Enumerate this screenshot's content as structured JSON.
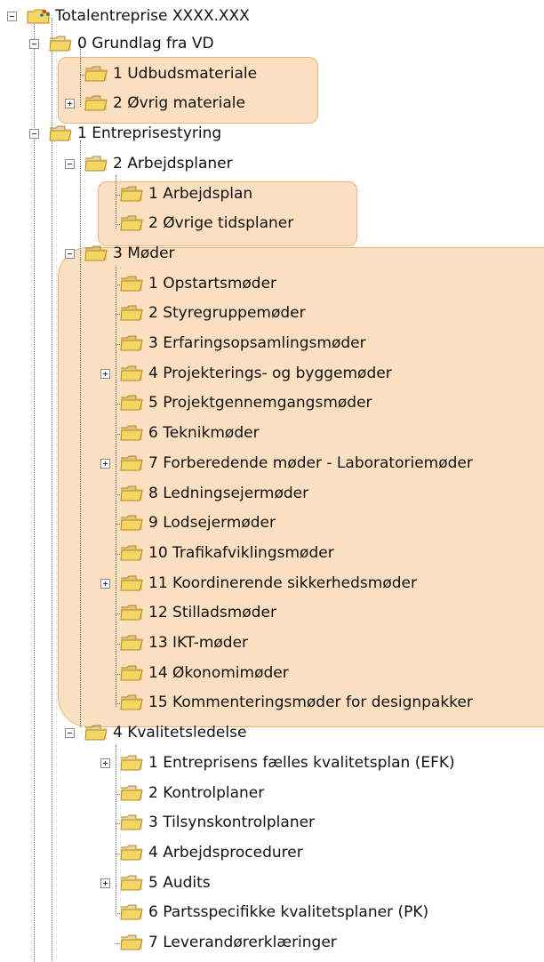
{
  "tree": {
    "root": {
      "label": "Totalentreprise XXXX.XXX",
      "icon": "project-root-icon"
    },
    "items": [
      {
        "label": "0 Grundlag fra VD",
        "level": 1,
        "expander": "minus"
      },
      {
        "label": "1 Udbudsmateriale",
        "level": 2,
        "expander": "none"
      },
      {
        "label": "2 Øvrig materiale",
        "level": 2,
        "expander": "plus"
      },
      {
        "label": "1 Entreprisestyring",
        "level": 1,
        "expander": "minus"
      },
      {
        "label": "2 Arbejdsplaner",
        "level": 2,
        "expander": "minus"
      },
      {
        "label": "1 Arbejdsplan",
        "level": 3,
        "expander": "none"
      },
      {
        "label": "2 Øvrige tidsplaner",
        "level": 3,
        "expander": "none"
      },
      {
        "label": "3 Møder",
        "level": 2,
        "expander": "minus"
      },
      {
        "label": "1 Opstartsmøder",
        "level": 3,
        "expander": "none"
      },
      {
        "label": "2 Styregruppemøder",
        "level": 3,
        "expander": "none"
      },
      {
        "label": "3 Erfaringsopsamlingsmøder",
        "level": 3,
        "expander": "none"
      },
      {
        "label": "4 Projekterings- og byggemøder",
        "level": 3,
        "expander": "plus"
      },
      {
        "label": "5 Projektgennemgangsmøder",
        "level": 3,
        "expander": "none"
      },
      {
        "label": "6 Teknikmøder",
        "level": 3,
        "expander": "none"
      },
      {
        "label": "7 Forberedende møder - Laboratoriemøder",
        "level": 3,
        "expander": "plus"
      },
      {
        "label": "8 Ledningsejermøder",
        "level": 3,
        "expander": "none"
      },
      {
        "label": "9 Lodsejermøder",
        "level": 3,
        "expander": "none"
      },
      {
        "label": "10 Trafikafviklingsmøder",
        "level": 3,
        "expander": "none"
      },
      {
        "label": "11 Koordinerende sikkerhedsmøder",
        "level": 3,
        "expander": "plus"
      },
      {
        "label": "12 Stilladsmøder",
        "level": 3,
        "expander": "none"
      },
      {
        "label": "13 IKT-møder",
        "level": 3,
        "expander": "none"
      },
      {
        "label": "14 Økonomimøder",
        "level": 3,
        "expander": "none"
      },
      {
        "label": "15 Kommenteringsmøder for designpakker",
        "level": 3,
        "expander": "none"
      },
      {
        "label": "4 Kvalitetsledelse",
        "level": 2,
        "expander": "minus"
      },
      {
        "label": "1 Entreprisens fælles kvalitetsplan (EFK)",
        "level": 3,
        "expander": "plus"
      },
      {
        "label": "2 Kontrolplaner",
        "level": 3,
        "expander": "none"
      },
      {
        "label": "3 Tilsynskontrolplaner",
        "level": 3,
        "expander": "none"
      },
      {
        "label": "4 Arbejdsprocedurer",
        "level": 3,
        "expander": "none"
      },
      {
        "label": "5 Audits",
        "level": 3,
        "expander": "plus"
      },
      {
        "label": "6 Partsspecifikke kvalitetsplaner (PK)",
        "level": 3,
        "expander": "none"
      },
      {
        "label": "7 Leverandørerklæringer",
        "level": 3,
        "expander": "none"
      }
    ]
  },
  "colors": {
    "highlight_fill": "#fbdfc1",
    "highlight_border": "#eab47a",
    "folder_fill": "#f4d665",
    "folder_edge": "#b48a1c",
    "tree_line": "#6f6f6f"
  }
}
